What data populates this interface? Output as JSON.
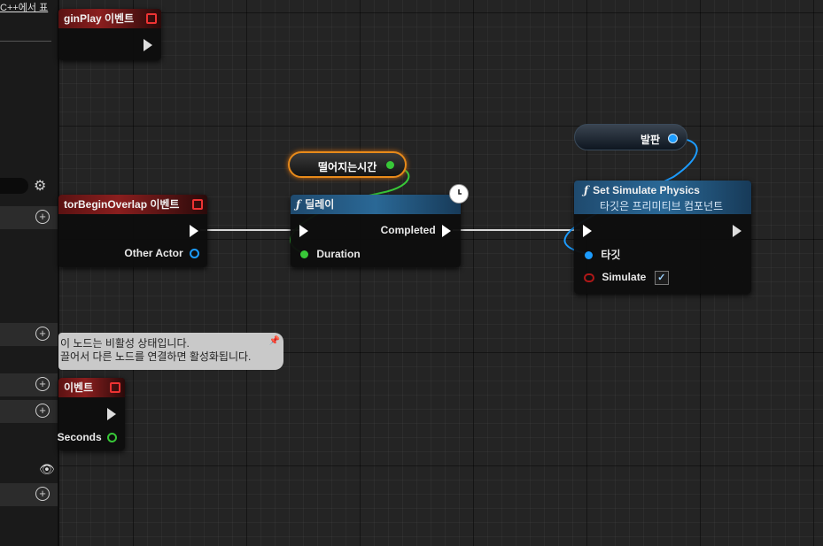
{
  "sidebar": {
    "top_link": "C++에서 표",
    "gear_icon": "gear-icon",
    "plus_icon": "⊕",
    "eye_icon": "👁"
  },
  "nodes": {
    "begin_play": {
      "title": "ginPlay 이벤트"
    },
    "overlap": {
      "title": "torBeginOverlap 이벤트",
      "pin_other_actor": "Other Actor"
    },
    "timer_event": {
      "title": "이벤트",
      "pin_seconds": "Seconds"
    },
    "delay": {
      "fn_glyph": "ƒ",
      "title": "딜레이",
      "pin_completed": "Completed",
      "pin_duration": "Duration",
      "clock_icon": "clock-icon"
    },
    "set_sim": {
      "fn_glyph": "ƒ",
      "title": "Set Simulate Physics",
      "subtitle": "타깃은 프리미티브 컴포넌트",
      "pin_target": "타깃",
      "pin_simulate": "Simulate",
      "simulate_checked": "✓"
    }
  },
  "variables": {
    "fall_time": "떨어지는시간",
    "platform": "발판"
  },
  "comment": {
    "line1": "이 노드는 비활성 상태입니다.",
    "line2": "끌어서 다른 노드를 연결하면 활성화됩니다."
  },
  "colors": {
    "exec": "#ffffff",
    "float_pin": "#38c838",
    "object_pin": "#1c9cff",
    "bool_pin": "#b01818"
  }
}
